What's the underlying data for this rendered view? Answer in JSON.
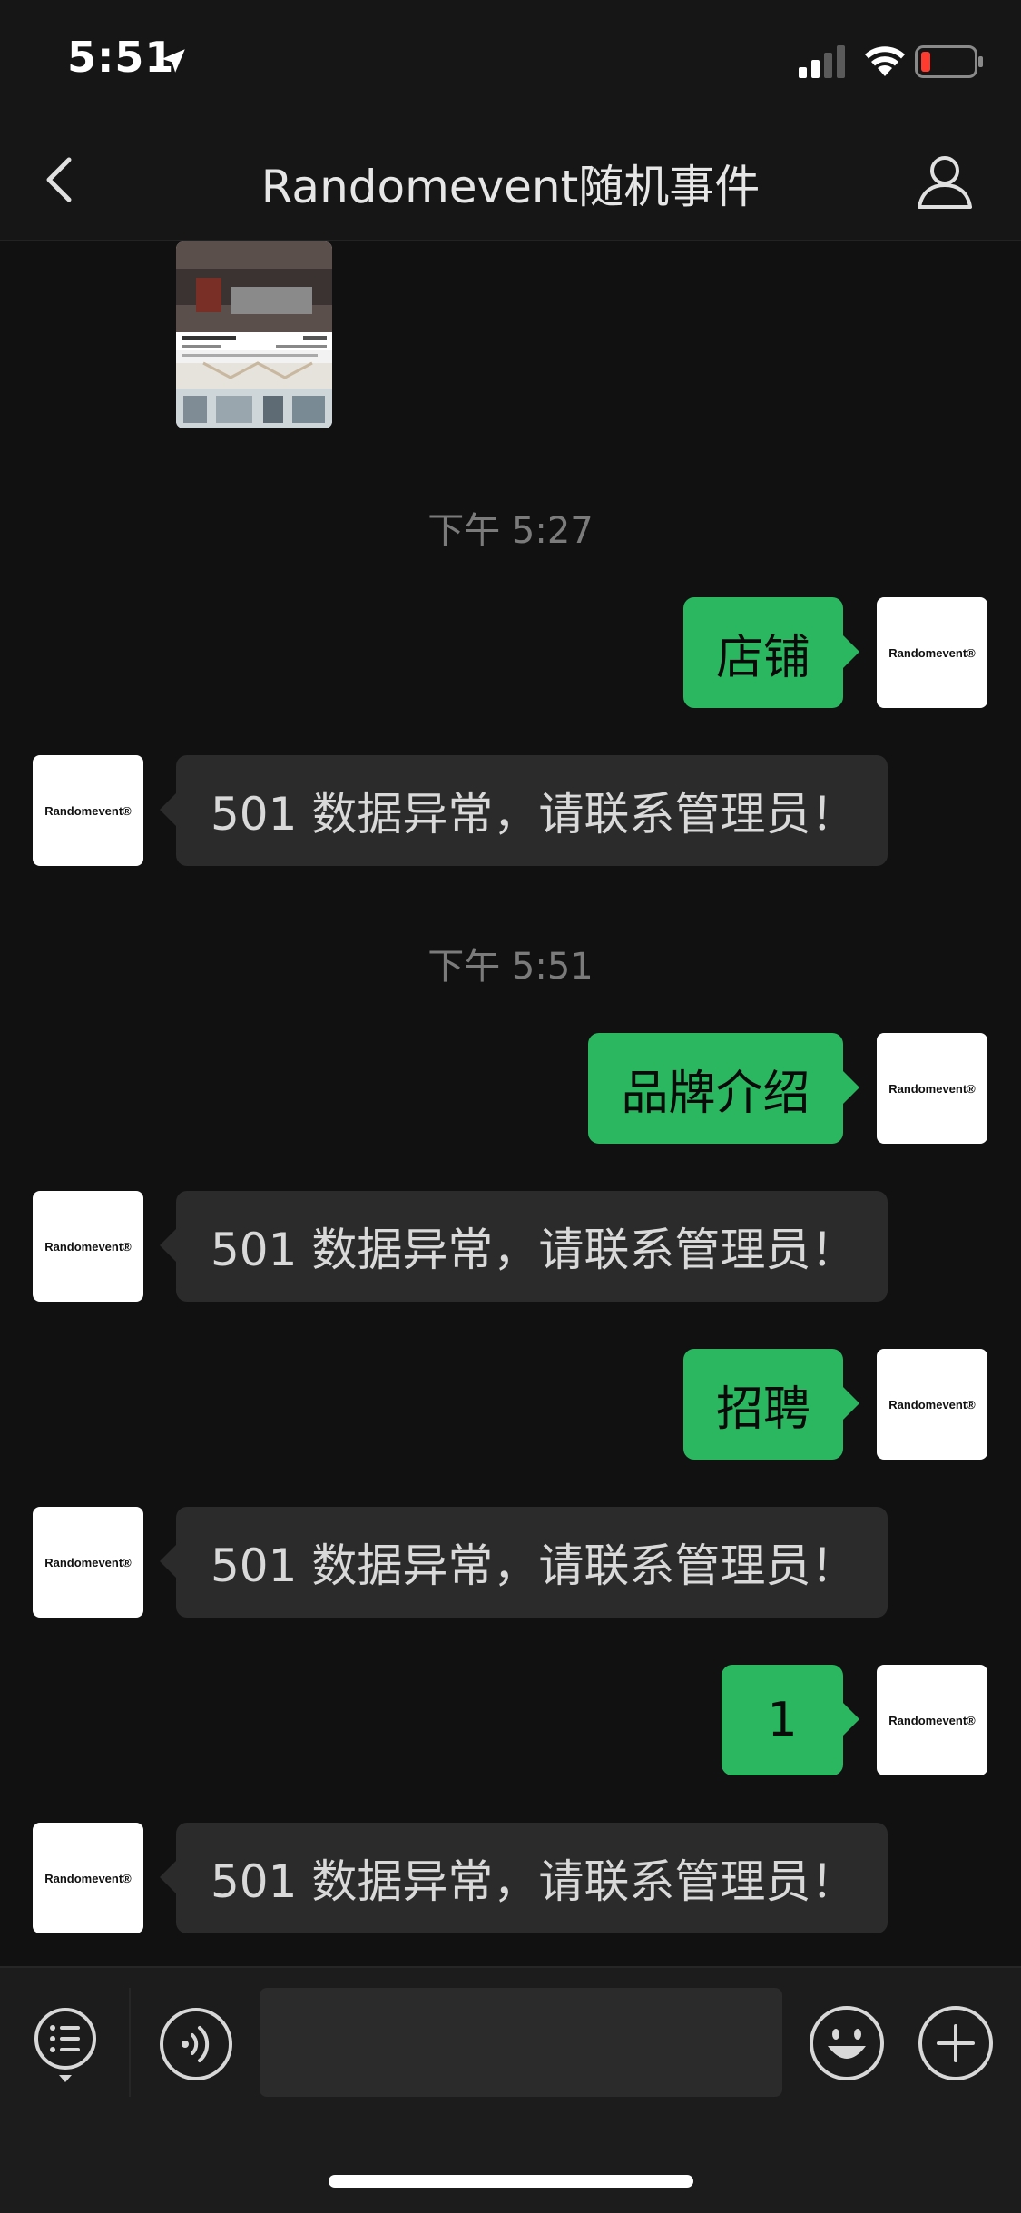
{
  "status_bar": {
    "time": "5:51"
  },
  "header": {
    "title": "Randomevent随机事件"
  },
  "avatar_label": "Randomevent®",
  "messages": {
    "image_caption": "CHANGSHA STORE",
    "ts1": "下午 5:27",
    "ts2": "下午 5:51",
    "out1": "店铺",
    "in1": "501 数据异常，请联系管理员！",
    "out2": "品牌介绍",
    "in2": "501 数据异常，请联系管理员！",
    "out3": "招聘",
    "in3": "501 数据异常，请联系管理员！",
    "out4": "1",
    "in4": "501 数据异常，请联系管理员！"
  },
  "input": {
    "value": ""
  },
  "colors": {
    "accent": "#2ab760",
    "incoming_bubble": "#2b2b2b",
    "background": "#111111"
  }
}
